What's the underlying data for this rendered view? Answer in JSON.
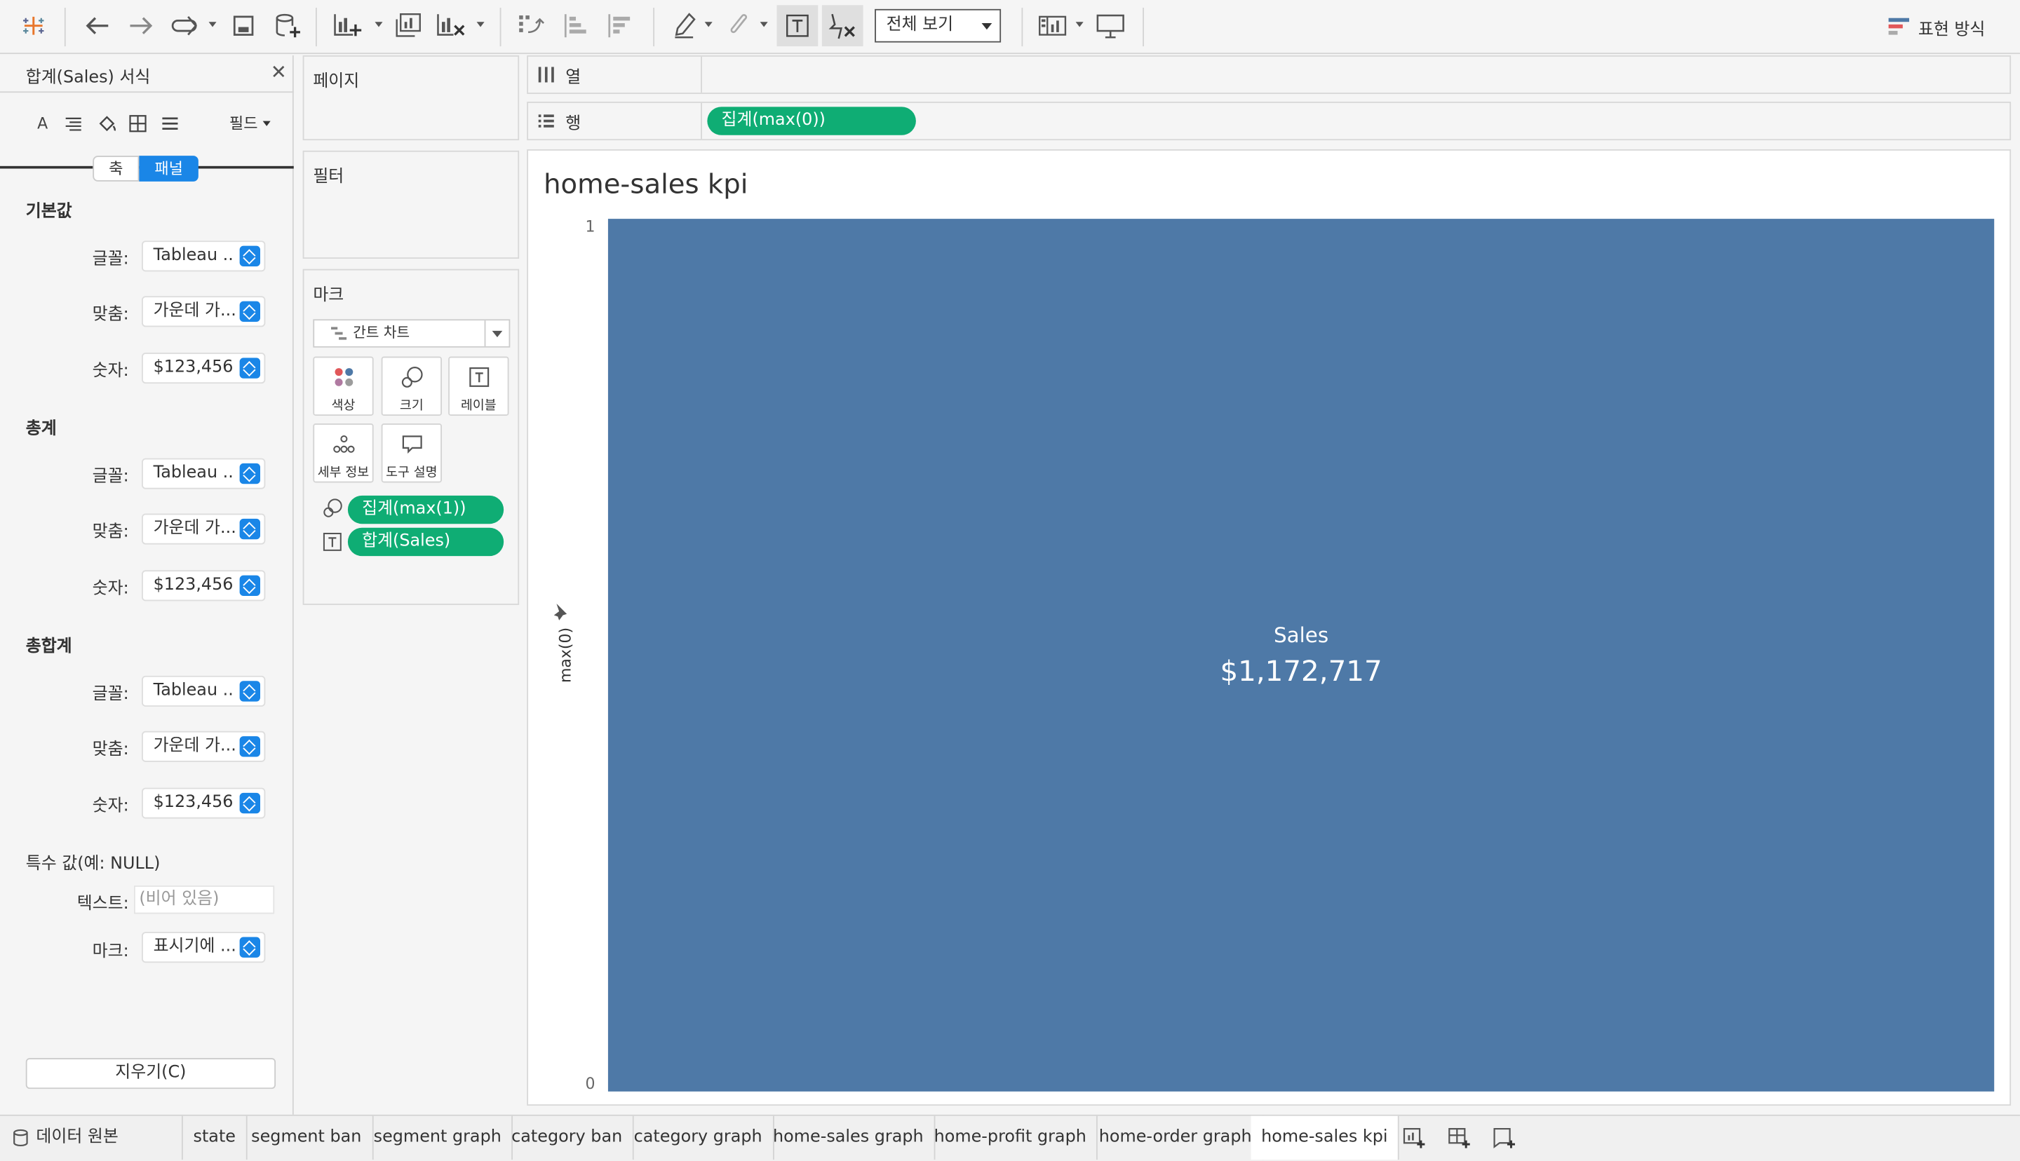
{
  "toolbar": {
    "view_mode": "전체 보기",
    "show_me": "표현 방식"
  },
  "format_pane": {
    "title": "합계(Sales) 서식",
    "fields_label": "필드",
    "tabs": {
      "axis": "축",
      "pane": "패널"
    },
    "sections": [
      {
        "title": "기본값",
        "rows": [
          {
            "label": "글꼴:",
            "value": "Tableau .."
          },
          {
            "label": "맞춤:",
            "value": "가운데 가..."
          },
          {
            "label": "숫자:",
            "value": "$123,456"
          }
        ]
      },
      {
        "title": "총계",
        "rows": [
          {
            "label": "글꼴:",
            "value": "Tableau .."
          },
          {
            "label": "맞춤:",
            "value": "가운데 가..."
          },
          {
            "label": "숫자:",
            "value": "$123,456"
          }
        ]
      },
      {
        "title": "총합계",
        "rows": [
          {
            "label": "글꼴:",
            "value": "Tableau .."
          },
          {
            "label": "맞춤:",
            "value": "가운데 가..."
          },
          {
            "label": "숫자:",
            "value": "$123,456"
          }
        ]
      }
    ],
    "special": {
      "title": "특수 값(예: NULL)",
      "text_label": "텍스트:",
      "text_placeholder": "(비어 있음)",
      "mark_label": "마크:",
      "mark_value": "표시기에 ..."
    },
    "clear_button": "지우기(C)"
  },
  "cards": {
    "pages": "페이지",
    "filters": "필터",
    "marks": {
      "title": "마크",
      "mark_type": "간트 차트",
      "buttons": [
        "색상",
        "크기",
        "레이블",
        "세부 정보",
        "도구 설명"
      ],
      "pills": [
        "집계(max(1))",
        "합계(Sales)"
      ]
    }
  },
  "shelves": {
    "columns": "열",
    "rows": "행",
    "row_pill": "집계(max(0))"
  },
  "view": {
    "title": "home-sales kpi",
    "axis_title": "max(0)",
    "axis_top_tick": "1",
    "axis_bottom_tick": "0",
    "mark_label": "Sales",
    "mark_value": "$1,172,717",
    "mark_color": "#4e79a7"
  },
  "chart_data": {
    "type": "bar",
    "title": "home-sales kpi",
    "ylabel": "max(0)",
    "ylim": [
      0,
      1
    ],
    "categories": [
      "Sales"
    ],
    "values": [
      1172717
    ],
    "series": [
      {
        "name": "Sales",
        "values": [
          1172717
        ]
      }
    ]
  },
  "bottom_tabs": {
    "data_source": "데이터 원본",
    "sheets": [
      "state",
      "segment ban",
      "segment graph",
      "category ban",
      "category graph",
      "home-sales graph",
      "home-profit graph",
      "home-order graph",
      "home-sales kpi"
    ],
    "active": "home-sales kpi"
  }
}
